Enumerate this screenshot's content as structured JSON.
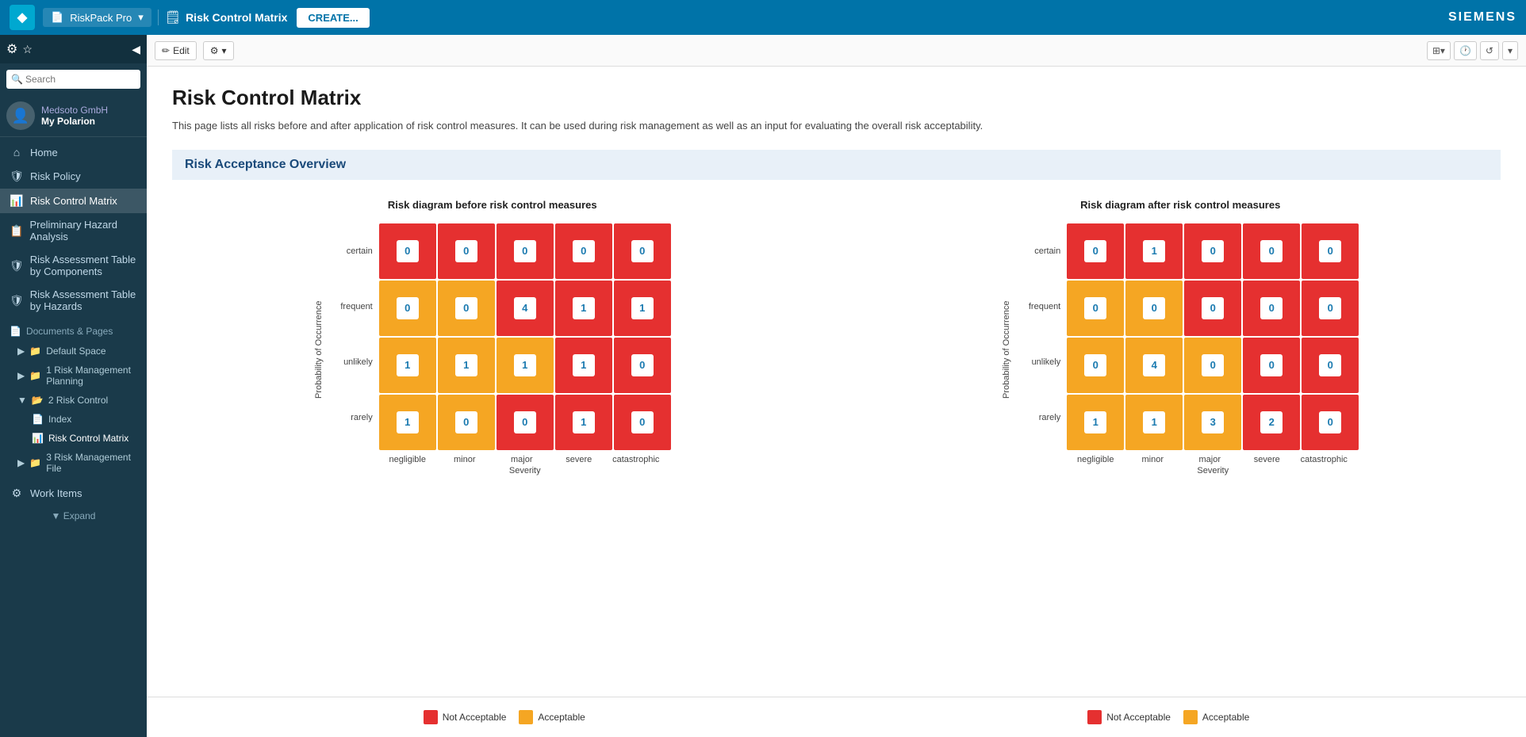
{
  "topbar": {
    "logo_text": "◆",
    "app_name": "RiskPack Pro",
    "doc_icon": "📄",
    "page_title": "Risk Control Matrix",
    "create_label": "CREATE...",
    "siemens_label": "SIEMENS"
  },
  "toolbar": {
    "edit_label": "Edit",
    "gear_icon": "⚙",
    "dropdown_icon": "▾",
    "layout_icon": "⊞",
    "clock_icon": "🕐",
    "refresh_icon": "↺",
    "more_icon": "▾"
  },
  "sidebar": {
    "collapse_icon": "◀",
    "search_placeholder": "Search",
    "user": {
      "org": "Medsoto GmbH",
      "name": "My Polarion"
    },
    "nav_items": [
      {
        "icon": "⌂",
        "label": "Home"
      },
      {
        "icon": "🛡",
        "label": "Risk Policy"
      },
      {
        "icon": "📊",
        "label": "Risk Control Matrix",
        "active": true
      }
    ],
    "tree": {
      "header": "Documents & Pages",
      "items": [
        {
          "label": "Default Space",
          "indent": 0,
          "icon": "📁"
        },
        {
          "label": "1 Risk Management Planning",
          "indent": 1,
          "icon": "📁"
        },
        {
          "label": "2 Risk Control",
          "indent": 1,
          "icon": "📂",
          "expanded": true
        },
        {
          "label": "Index",
          "indent": 2,
          "icon": "📄"
        },
        {
          "label": "Risk Control Matrix",
          "indent": 2,
          "icon": "📊",
          "active": true
        },
        {
          "label": "3 Risk Management File",
          "indent": 1,
          "icon": "📁"
        }
      ],
      "work_items_label": "Work Items",
      "preliminary_hazard_label": "Preliminary Hazard Analysis",
      "risk_assessment_components": "Risk Assessment Table by Components",
      "risk_assessment_hazards": "Risk Assessment Table by Hazards",
      "risk_control_matrix": "Risk Control Matrix",
      "expand_label": "▼ Expand"
    }
  },
  "page": {
    "title": "Risk Control Matrix",
    "description": "This page lists all risks before and after application of risk control measures. It can be used during risk management as well as an input for evaluating the overall risk acceptability.",
    "section_title": "Risk Acceptance Overview"
  },
  "diagram_before": {
    "title": "Risk diagram before risk control measures",
    "y_label": "Probability of Occurrence",
    "x_label": "Severity",
    "row_labels": [
      "certain",
      "frequent",
      "unlikely",
      "rarely"
    ],
    "col_labels": [
      "negligible",
      "minor",
      "major",
      "severe",
      "catastrophic"
    ],
    "cells": [
      {
        "row": 0,
        "col": 0,
        "value": "0",
        "type": "red"
      },
      {
        "row": 0,
        "col": 1,
        "value": "0",
        "type": "red"
      },
      {
        "row": 0,
        "col": 2,
        "value": "0",
        "type": "red"
      },
      {
        "row": 0,
        "col": 3,
        "value": "0",
        "type": "red"
      },
      {
        "row": 0,
        "col": 4,
        "value": "0",
        "type": "red"
      },
      {
        "row": 1,
        "col": 0,
        "value": "0",
        "type": "orange"
      },
      {
        "row": 1,
        "col": 1,
        "value": "0",
        "type": "orange"
      },
      {
        "row": 1,
        "col": 2,
        "value": "4",
        "type": "red"
      },
      {
        "row": 1,
        "col": 3,
        "value": "1",
        "type": "red"
      },
      {
        "row": 1,
        "col": 4,
        "value": "1",
        "type": "red"
      },
      {
        "row": 2,
        "col": 0,
        "value": "1",
        "type": "orange"
      },
      {
        "row": 2,
        "col": 1,
        "value": "1",
        "type": "orange"
      },
      {
        "row": 2,
        "col": 2,
        "value": "1",
        "type": "orange"
      },
      {
        "row": 2,
        "col": 3,
        "value": "1",
        "type": "red"
      },
      {
        "row": 2,
        "col": 4,
        "value": "0",
        "type": "red"
      },
      {
        "row": 3,
        "col": 0,
        "value": "1",
        "type": "orange"
      },
      {
        "row": 3,
        "col": 1,
        "value": "0",
        "type": "orange"
      },
      {
        "row": 3,
        "col": 2,
        "value": "0",
        "type": "red"
      },
      {
        "row": 3,
        "col": 3,
        "value": "1",
        "type": "red"
      },
      {
        "row": 3,
        "col": 4,
        "value": "0",
        "type": "red"
      }
    ]
  },
  "diagram_after": {
    "title": "Risk diagram after risk control measures",
    "y_label": "Probability of Occurrence",
    "x_label": "Severity",
    "row_labels": [
      "certain",
      "frequent",
      "unlikely",
      "rarely"
    ],
    "col_labels": [
      "negligible",
      "minor",
      "major",
      "severe",
      "catastrophic"
    ],
    "cells": [
      {
        "row": 0,
        "col": 0,
        "value": "0",
        "type": "red"
      },
      {
        "row": 0,
        "col": 1,
        "value": "1",
        "type": "red"
      },
      {
        "row": 0,
        "col": 2,
        "value": "0",
        "type": "red"
      },
      {
        "row": 0,
        "col": 3,
        "value": "0",
        "type": "red"
      },
      {
        "row": 0,
        "col": 4,
        "value": "0",
        "type": "red"
      },
      {
        "row": 1,
        "col": 0,
        "value": "0",
        "type": "orange"
      },
      {
        "row": 1,
        "col": 1,
        "value": "0",
        "type": "orange"
      },
      {
        "row": 1,
        "col": 2,
        "value": "0",
        "type": "red"
      },
      {
        "row": 1,
        "col": 3,
        "value": "0",
        "type": "red"
      },
      {
        "row": 1,
        "col": 4,
        "value": "0",
        "type": "red"
      },
      {
        "row": 2,
        "col": 0,
        "value": "0",
        "type": "orange"
      },
      {
        "row": 2,
        "col": 1,
        "value": "4",
        "type": "orange"
      },
      {
        "row": 2,
        "col": 2,
        "value": "0",
        "type": "orange"
      },
      {
        "row": 2,
        "col": 3,
        "value": "0",
        "type": "red"
      },
      {
        "row": 2,
        "col": 4,
        "value": "0",
        "type": "red"
      },
      {
        "row": 3,
        "col": 0,
        "value": "1",
        "type": "orange"
      },
      {
        "row": 3,
        "col": 1,
        "value": "1",
        "type": "orange"
      },
      {
        "row": 3,
        "col": 2,
        "value": "3",
        "type": "orange"
      },
      {
        "row": 3,
        "col": 3,
        "value": "2",
        "type": "red"
      },
      {
        "row": 3,
        "col": 4,
        "value": "0",
        "type": "red"
      }
    ]
  },
  "legend": {
    "not_acceptable_label": "Not Acceptable",
    "acceptable_label": "Acceptable",
    "not_acceptable_color": "#e53030",
    "acceptable_color": "#f5a623"
  }
}
